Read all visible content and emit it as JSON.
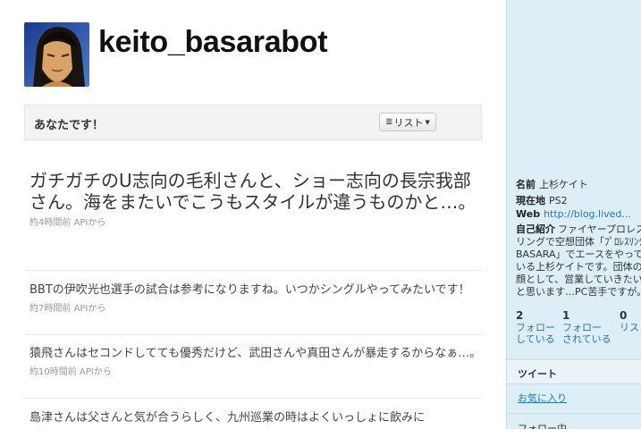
{
  "profile": {
    "screen_name": "keito_basarabot",
    "you_label": "あなたです！",
    "list_button": "リスト"
  },
  "tweets": [
    {
      "text": "ガチガチのU志向の毛利さんと、ショー志向の長宗我部さん。海をまたいでこうもスタイルが違うものかと…。",
      "time": "約4時間前",
      "source": "APIから"
    },
    {
      "text": "BBTの伊吹光也選手の試合は参考になりますね。いつかシングルやってみたいです！",
      "time": "約7時間前",
      "source": "APIから"
    },
    {
      "text": "猿飛さんはセコンドしてても優秀だけど、武田さんや真田さんが暴走するからなぁ…。",
      "time": "約10時間前",
      "source": "APIから"
    },
    {
      "text": "島津さんは父さんと気が合うらしく、九州巡業の時はよくいっしょに飲みに",
      "time": "",
      "source": ""
    }
  ],
  "sidebar": {
    "name_label": "名前",
    "name_value": "上杉ケイト",
    "location_label": "現在地",
    "location_value": "PS2",
    "web_label": "Web",
    "web_value": "http://blog.lived...",
    "bio_label": "自己紹介",
    "bio_text": "ファイヤープロレスリングで空想団体「ﾌﾟﾛﾚｽﾘﾝｸﾞBASARA」でエースをやっている上杉ケイトです。団体の顔として、営業していきたいと思います…PC苦手ですが。",
    "stats": [
      {
        "count": "2",
        "label_1": "フォロー",
        "label_2": "している"
      },
      {
        "count": "1",
        "label_1": "フォロー",
        "label_2": "されている"
      },
      {
        "count": "0",
        "label_1": "リスト",
        "label_2": ""
      }
    ],
    "tweets_label": "ツイート",
    "favorites_label": "お気に入り",
    "following_label": "フォロー中"
  },
  "colors": {
    "sidebar_bg": "#ddeef6",
    "link": "#2276bb"
  }
}
